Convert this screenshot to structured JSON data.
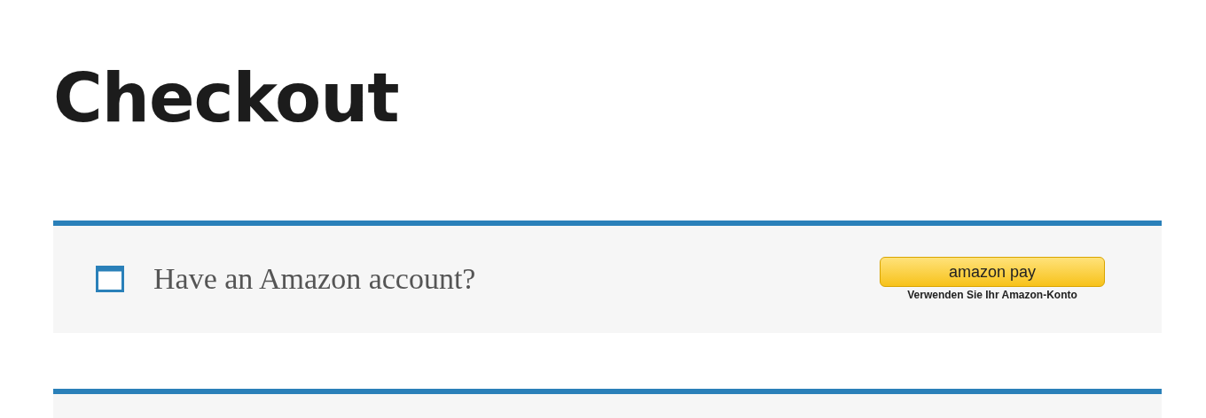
{
  "title": "Checkout",
  "notice": {
    "text": "Have an Amazon account?",
    "button": {
      "logo": "amazon pay",
      "caption": "Verwenden Sie Ihr Amazon-Konto"
    }
  }
}
